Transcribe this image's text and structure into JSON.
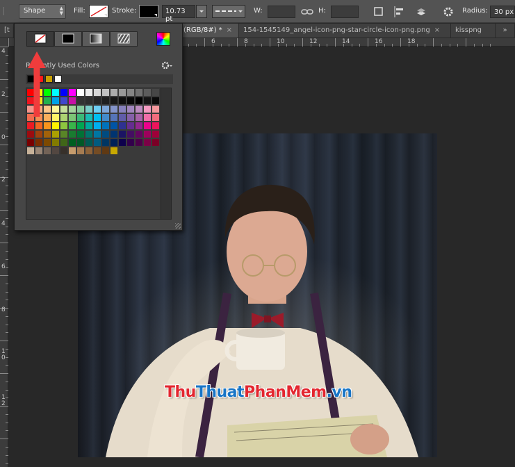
{
  "options_bar": {
    "mode": "Shape",
    "fill_label": "Fill:",
    "stroke_label": "Stroke:",
    "stroke_width": "10.73 pt",
    "w_label": "W:",
    "h_label": "H:",
    "radius_label": "Radius:",
    "radius_value": "30 px"
  },
  "tabs": [
    {
      "label": "[t"
    },
    {
      "label": "(RGB/8#) *",
      "close": "×"
    },
    {
      "label": "154-1545149_angel-icon-png-star-circle-icon-png.png",
      "close": "×"
    },
    {
      "label": "kisspng"
    },
    {
      "label": "»"
    }
  ],
  "ruler": {
    "h_numbers": [
      "6",
      "8",
      "10",
      "12",
      "14",
      "16",
      "18"
    ],
    "v_numbers": [
      "4",
      "2",
      "0",
      "2",
      "4",
      "6",
      "8",
      "1\n0",
      "1\n2"
    ]
  },
  "fill_panel": {
    "recent_label": "Recently Used Colors",
    "recent_colors": [
      "#000000",
      "#ff1818",
      "#c8a000",
      "#ffffff"
    ],
    "swatch_rows": [
      [
        "#ff0000",
        "#ffff00",
        "#00ff00",
        "#00ffff",
        "#0000ff",
        "#ff00ff",
        "#ffffff",
        "#ebebeb",
        "#d6d6d6",
        "#c2c2c2",
        "#adadad",
        "#999999",
        "#858585",
        "#707070",
        "#5c5c5c",
        "#474747"
      ],
      [
        "#f0141e",
        "#f5ea1b",
        "#23b14d",
        "#00a2e8",
        "#3f48cc",
        "#c710a6",
        "#333333",
        "#2e2e2e",
        "#262626",
        "#1f1f1f",
        "#171717",
        "#0f0f0f",
        "#080808",
        "#000000",
        "#141414",
        "#0a0a0a"
      ],
      [
        "#f6968c",
        "#f9ad81",
        "#fdc689",
        "#fff799",
        "#c4df9b",
        "#a3d39c",
        "#82ca9c",
        "#7accc8",
        "#6dcff6",
        "#7da7d9",
        "#8393ca",
        "#8781bd",
        "#a186be",
        "#bd8cbf",
        "#f49ac1",
        "#f5989d"
      ],
      [
        "#f26c4f",
        "#f68e55",
        "#fbaf5c",
        "#fff467",
        "#acd372",
        "#7cc576",
        "#3bb878",
        "#1abbb4",
        "#00bff3",
        "#438ccb",
        "#5574b9",
        "#605ca8",
        "#8560a8",
        "#a763a8",
        "#f06ea9",
        "#f26d7d"
      ],
      [
        "#ed1c24",
        "#f26522",
        "#f7941d",
        "#fff200",
        "#8dc63f",
        "#39b54a",
        "#00a651",
        "#00a99d",
        "#00aeef",
        "#0072bc",
        "#0054a6",
        "#2e3192",
        "#662d91",
        "#92278f",
        "#ec008c",
        "#ed145b"
      ],
      [
        "#9e0b0f",
        "#a0410d",
        "#a3620a",
        "#aba000",
        "#598527",
        "#1a7b30",
        "#007236",
        "#00746b",
        "#0076a3",
        "#004b80",
        "#003471",
        "#1b1464",
        "#440e62",
        "#630460",
        "#9e005d",
        "#9e0039"
      ],
      [
        "#790000",
        "#7b2e00",
        "#7d4900",
        "#827b00",
        "#406618",
        "#005e20",
        "#005826",
        "#005952",
        "#005b7f",
        "#003663",
        "#002157",
        "#0d004c",
        "#32004b",
        "#4b0049",
        "#7b0046",
        "#7a0026"
      ],
      [
        "#c7b299",
        "#998675",
        "#736357",
        "#534741",
        "#37302a",
        "#c69c6d",
        "#a67c52",
        "#8c6239",
        "#754c24",
        "#603913",
        "#c8a800"
      ]
    ]
  },
  "watermark": {
    "part1": "Thu",
    "part2": "Thuat",
    "part3": "PhanMem",
    "part4": ".vn",
    "colors": {
      "red": "#e3262f",
      "blue": "#1875c6"
    }
  },
  "colors": {
    "ui_bg": "#535353",
    "canvas_bg": "#282828",
    "panel_bg": "#464646",
    "annotation_red": "#f03c3c"
  }
}
